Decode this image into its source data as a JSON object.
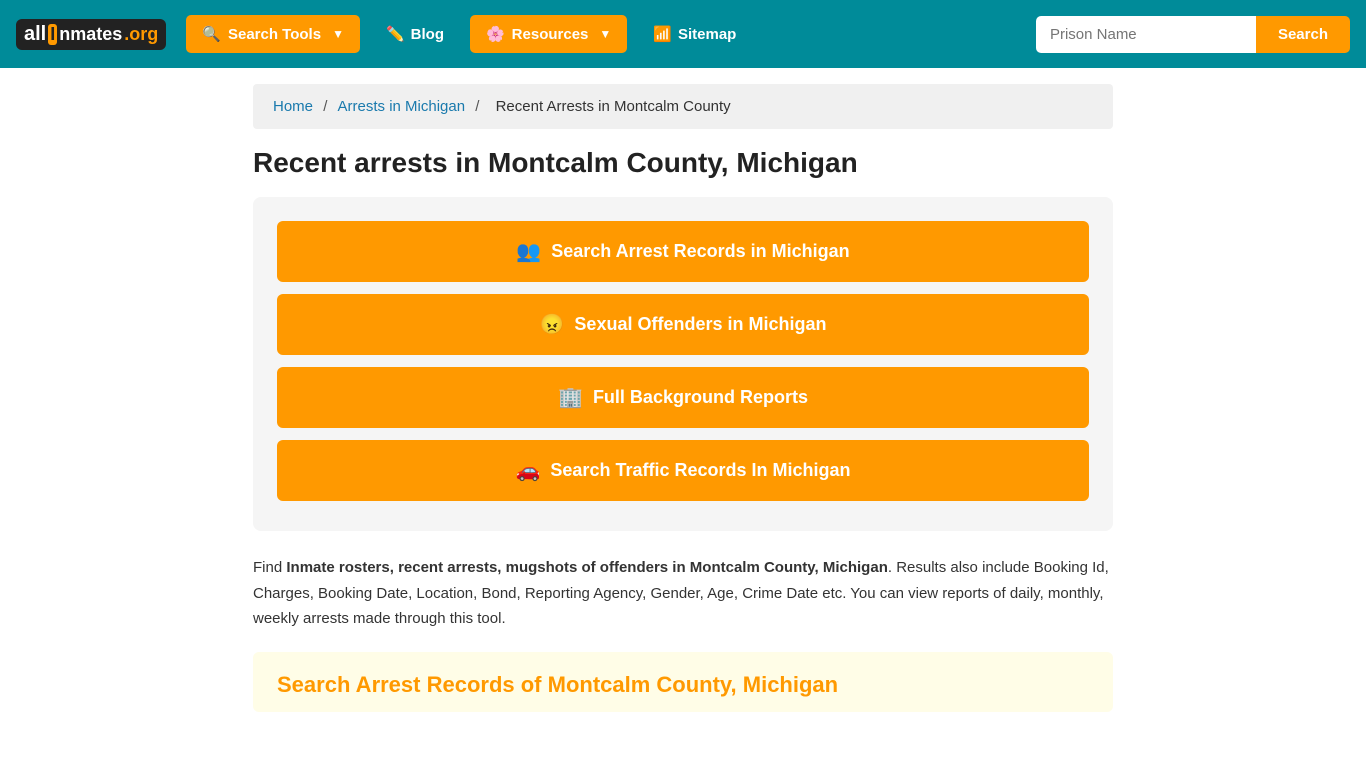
{
  "site": {
    "logo": {
      "all": "all",
      "i_special": "I",
      "nmates": "nmates",
      "org": ".org"
    }
  },
  "navbar": {
    "search_tools_label": "Search Tools",
    "blog_label": "Blog",
    "resources_label": "Resources",
    "sitemap_label": "Sitemap",
    "search_placeholder": "Prison Name",
    "search_btn_label": "Search"
  },
  "breadcrumb": {
    "home": "Home",
    "arrests_in_michigan": "Arrests in Michigan",
    "current": "Recent Arrests in Montcalm County"
  },
  "main": {
    "page_title": "Recent arrests in Montcalm County, Michigan",
    "buttons": [
      {
        "icon": "👥",
        "label": "Search Arrest Records in Michigan"
      },
      {
        "icon": "😠",
        "label": "Sexual Offenders in Michigan"
      },
      {
        "icon": "🏢",
        "label": "Full Background Reports"
      },
      {
        "icon": "🚗",
        "label": "Search Traffic Records In Michigan"
      }
    ],
    "description_prefix": "Find ",
    "description_bold": "Inmate rosters, recent arrests, mugshots of offenders in Montcalm County, Michigan",
    "description_suffix": ". Results also include Booking Id, Charges, Booking Date, Location, Bond, Reporting Agency, Gender, Age, Crime Date etc. You can view reports of daily, monthly, weekly arrests made through this tool.",
    "section_title": "Search Arrest Records of Montcalm County, Michigan"
  }
}
